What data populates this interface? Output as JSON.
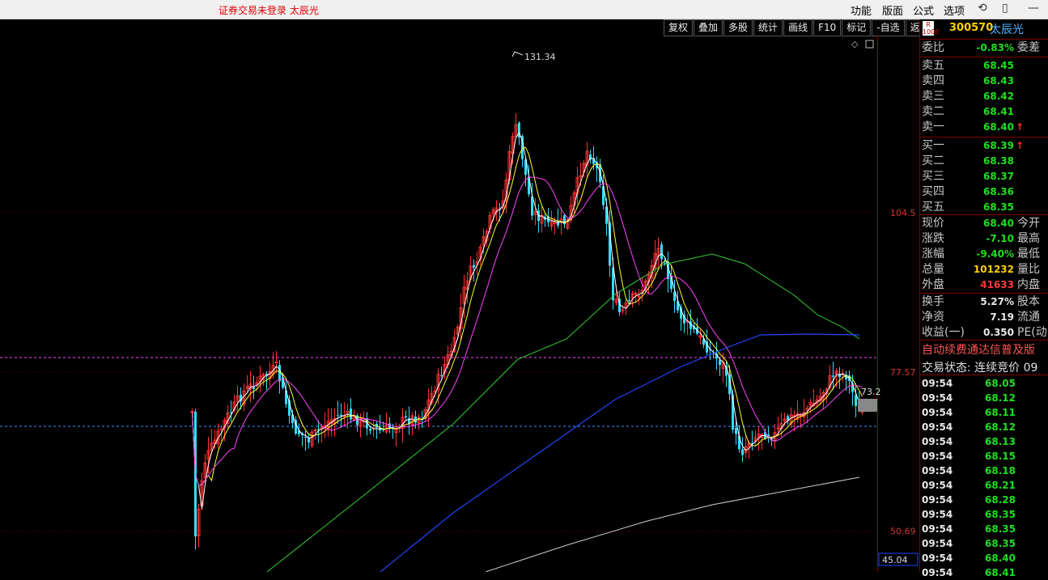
{
  "title_bar": {
    "status": "证券交易未登录   太辰光",
    "menus": [
      "功能",
      "版面",
      "公式",
      "选项"
    ]
  },
  "toolbar": [
    "复权",
    "叠加",
    "多股",
    "统计",
    "画线",
    "F10",
    "标记",
    "-自选",
    "返回"
  ],
  "chart_data": {
    "type": "candlestick",
    "axis_labels": [
      "104.5",
      "77.57",
      "50.69"
    ],
    "axis_values": [
      104.5,
      77.57,
      50.69
    ],
    "peak_label": "131.34",
    "peak_value": 131.34,
    "current_marker": "73.2",
    "bottom_value": "45.04",
    "ma_colors": {
      "ma5": "#ffffff",
      "ma10": "#ffff33",
      "ma20": "#ff44ff",
      "ma60": "#33cc33",
      "ma120": "#2244ff",
      "ma250": "#cccccc"
    },
    "up_color": "#ff3333",
    "down_color": "#33ddff"
  },
  "quote": {
    "code": "300570",
    "name": "太辰光",
    "r_badge": "R",
    "weibi": {
      "label": "委比",
      "value": "-0.83%",
      "label2": "委差"
    },
    "asks": [
      {
        "label": "卖五",
        "price": "68.45"
      },
      {
        "label": "卖四",
        "price": "68.43"
      },
      {
        "label": "卖三",
        "price": "68.42"
      },
      {
        "label": "卖二",
        "price": "68.41"
      },
      {
        "label": "卖一",
        "price": "68.40",
        "arrow": "↑"
      }
    ],
    "bids": [
      {
        "label": "买一",
        "price": "68.39",
        "arrow": "↑"
      },
      {
        "label": "买二",
        "price": "68.38"
      },
      {
        "label": "买三",
        "price": "68.37"
      },
      {
        "label": "买四",
        "price": "68.36"
      },
      {
        "label": "买五",
        "price": "68.35"
      }
    ],
    "stats": [
      {
        "label": "现价",
        "value": "68.40",
        "label2": "今开",
        "color": "green"
      },
      {
        "label": "涨跌",
        "value": "-7.10",
        "label2": "最高",
        "color": "green"
      },
      {
        "label": "涨幅",
        "value": "-9.40%",
        "label2": "最低",
        "color": "green"
      },
      {
        "label": "总量",
        "value": "101232",
        "label2": "量比",
        "color": "yellow"
      },
      {
        "label": "外盘",
        "value": "41633",
        "label2": "内盘",
        "color": "red"
      }
    ],
    "fundamentals": [
      {
        "label": "换手",
        "value": "5.27%",
        "label2": "股本"
      },
      {
        "label": "净资",
        "value": "7.19",
        "label2": "流通"
      },
      {
        "label": "收益(一)",
        "value": "0.350",
        "label2": "PE(动"
      }
    ],
    "auto_text": "自动续费通达信普及版",
    "trade_status": "交易状态: 连续竞价  09",
    "ticks": [
      {
        "time": "09:54",
        "price": "68.05"
      },
      {
        "time": "09:54",
        "price": "68.12"
      },
      {
        "time": "09:54",
        "price": "68.11"
      },
      {
        "time": "09:54",
        "price": "68.12"
      },
      {
        "time": "09:54",
        "price": "68.13"
      },
      {
        "time": "09:54",
        "price": "68.15"
      },
      {
        "time": "09:54",
        "price": "68.18"
      },
      {
        "time": "09:54",
        "price": "68.21"
      },
      {
        "time": "09:54",
        "price": "68.28"
      },
      {
        "time": "09:54",
        "price": "68.35"
      },
      {
        "time": "09:54",
        "price": "68.35"
      },
      {
        "time": "09:54",
        "price": "68.35"
      },
      {
        "time": "09:54",
        "price": "68.40"
      },
      {
        "time": "09:54",
        "price": "68.41"
      }
    ]
  }
}
